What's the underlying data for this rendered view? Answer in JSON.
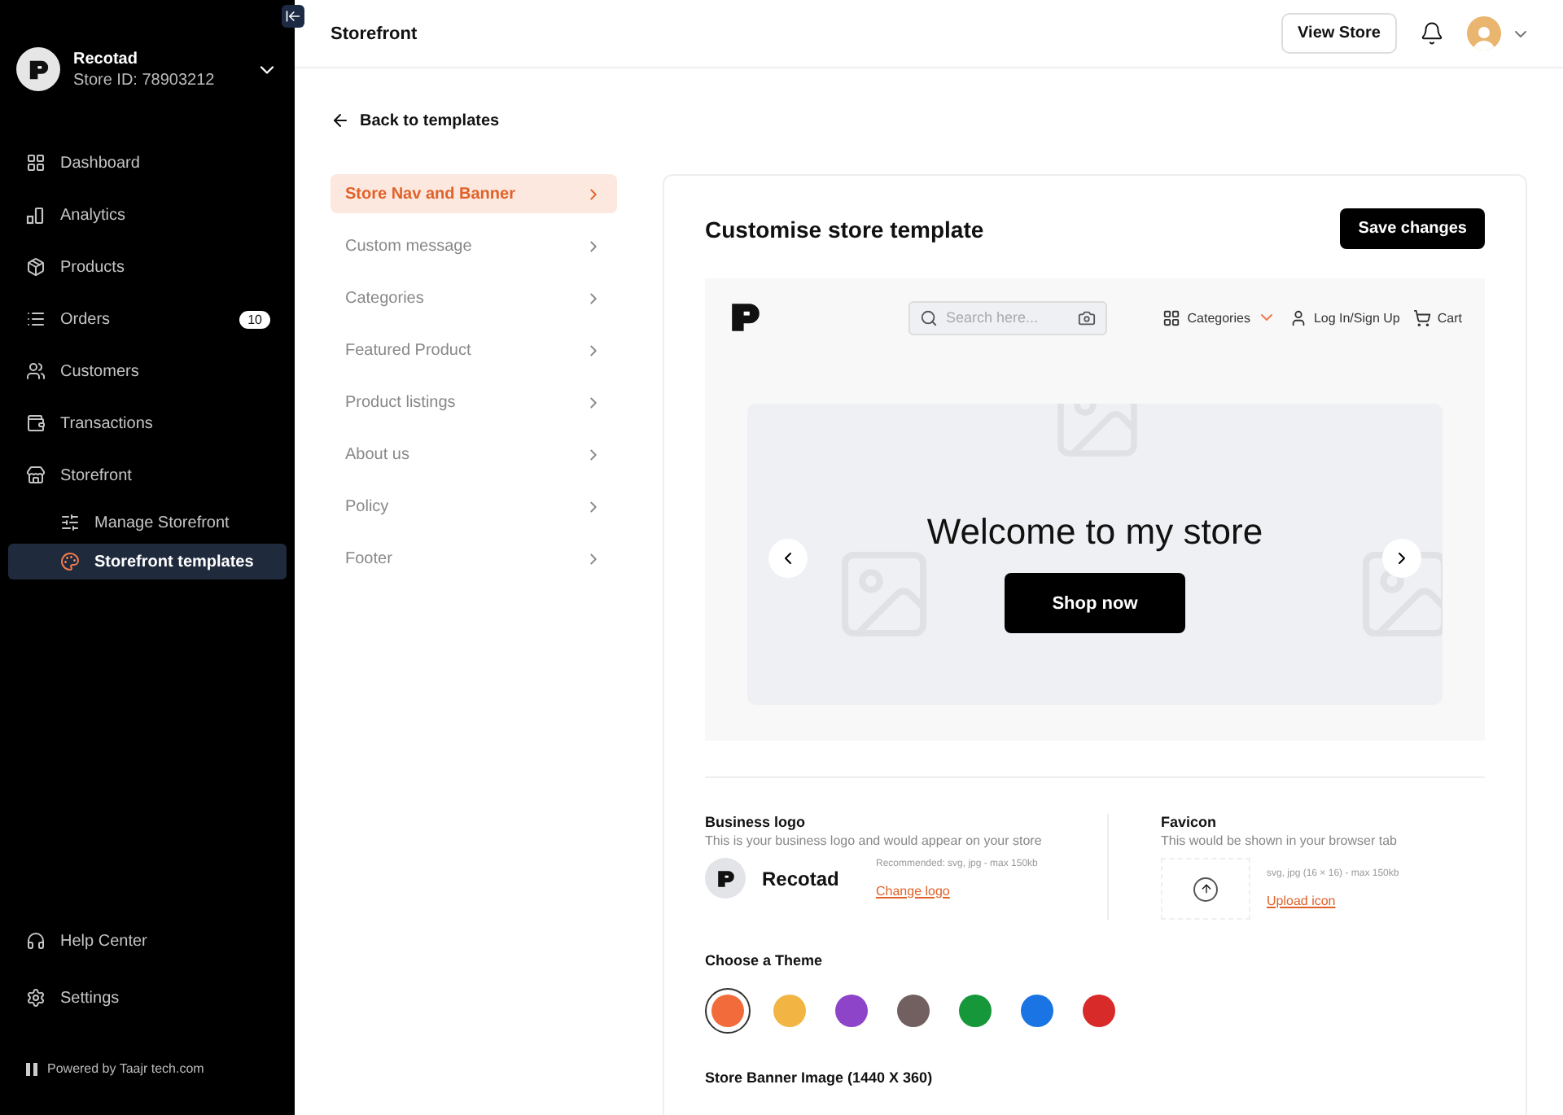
{
  "sidebar": {
    "store_name": "Recotad",
    "store_id": "Store ID: 78903212",
    "items": [
      {
        "label": "Dashboard",
        "selected": false
      },
      {
        "label": "Analytics",
        "selected": false
      },
      {
        "label": "Products",
        "selected": false
      },
      {
        "label": "Orders",
        "selected": false,
        "badge": "10"
      },
      {
        "label": "Customers",
        "selected": false
      },
      {
        "label": "Transactions",
        "selected": false
      },
      {
        "label": "Storefront",
        "selected": false,
        "children": [
          {
            "label": "Manage Storefront",
            "selected": false
          },
          {
            "label": "Storefront templates",
            "selected": true
          }
        ]
      }
    ],
    "footer_items": [
      {
        "label": "Help Center"
      },
      {
        "label": "Settings"
      }
    ],
    "powered_by": "Powered by Taajr tech.com"
  },
  "header": {
    "title": "Storefront",
    "view_store": "View Store"
  },
  "back_link": "Back to templates",
  "sections": [
    {
      "label": "Store Nav and Banner",
      "selected": true
    },
    {
      "label": "Custom message",
      "selected": false
    },
    {
      "label": "Categories",
      "selected": false
    },
    {
      "label": "Featured Product",
      "selected": false
    },
    {
      "label": "Product listings",
      "selected": false
    },
    {
      "label": "About us",
      "selected": false
    },
    {
      "label": "Policy",
      "selected": false
    },
    {
      "label": "Footer",
      "selected": false
    }
  ],
  "editor": {
    "title": "Customise store template",
    "save": "Save changes",
    "preview": {
      "search_placeholder": "Search here...",
      "categories": "Categories",
      "login": "Log In/Sign Up",
      "cart": "Cart",
      "banner_title": "Welcome to my store",
      "banner_button": "Shop now"
    },
    "logo": {
      "title": "Business logo",
      "description": "This is your business logo and would appear on your store",
      "name": "Recotad",
      "hint": "Recommended: svg, jpg - max 150kb",
      "action": "Change logo"
    },
    "favicon": {
      "title": "Favicon",
      "description": "This would be shown in your browser tab",
      "hint": "svg, jpg (16 × 16) - max 150kb",
      "action": "Upload icon"
    },
    "theme": {
      "title": "Choose a Theme",
      "colors": [
        {
          "color": "#f26b3a",
          "selected": true
        },
        {
          "color": "#f2b544",
          "selected": false
        },
        {
          "color": "#8e44c9",
          "selected": false
        },
        {
          "color": "#725f5f",
          "selected": false
        },
        {
          "color": "#16973a",
          "selected": false
        },
        {
          "color": "#1b74e4",
          "selected": false
        },
        {
          "color": "#d92a2a",
          "selected": false
        }
      ]
    },
    "banner_image": {
      "title": "Store Banner Image (1440 X 360)"
    }
  }
}
